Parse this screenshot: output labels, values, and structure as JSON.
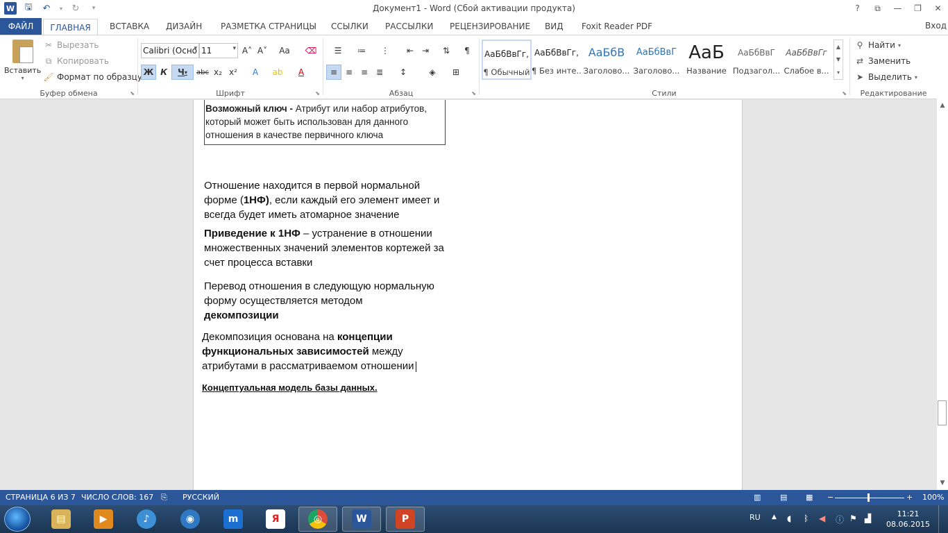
{
  "window": {
    "title": "Документ1 - Word (Сбой активации продукта)",
    "logo": "W",
    "help": "?",
    "controls": [
      "?",
      "⧉",
      "—",
      "❐",
      "✕"
    ]
  },
  "tabs": [
    {
      "label": "ФАЙЛ"
    },
    {
      "label": "ГЛАВНАЯ"
    },
    {
      "label": "ВСТАВКА"
    },
    {
      "label": "ДИЗАЙН"
    },
    {
      "label": "РАЗМЕТКА СТРАНИЦЫ"
    },
    {
      "label": "ССЫЛКИ"
    },
    {
      "label": "РАССЫЛКИ"
    },
    {
      "label": "РЕЦЕНЗИРОВАНИЕ"
    },
    {
      "label": "ВИД"
    },
    {
      "label": "Foxit Reader PDF"
    }
  ],
  "signin": "Вход",
  "clipboard": {
    "paste": "Вставить",
    "cut": "Вырезать",
    "copy": "Копировать",
    "format_painter": "Формат по образцу",
    "group": "Буфер обмена"
  },
  "font": {
    "name": "Calibri (Осно",
    "size": "11",
    "group": "Шрифт",
    "bold": "Ж",
    "italic": "К",
    "underline": "Ч",
    "strike": "abc",
    "sub": "x₂",
    "sup": "x²",
    "grow": "A˄",
    "shrink": "A˅",
    "case": "Aa",
    "clear": "A"
  },
  "paragraph": {
    "group": "Абзац"
  },
  "styles": {
    "group": "Стили",
    "items": [
      {
        "sample": "АаБбВвГг,",
        "name": "¶ Обычный"
      },
      {
        "sample": "АаБбВвГг,",
        "name": "¶ Без инте..."
      },
      {
        "sample": "АаБбВ",
        "name": "Заголово..."
      },
      {
        "sample": "АаБбВвГ",
        "name": "Заголово..."
      },
      {
        "sample": "АаБ",
        "name": "Название"
      },
      {
        "sample": "АаБбВвГ",
        "name": "Подзагол..."
      },
      {
        "sample": "АаБбВвГг",
        "name": "Слабое в..."
      }
    ]
  },
  "editing": {
    "group": "Редактирование",
    "find": "Найти",
    "replace": "Заменить",
    "select": "Выделить"
  },
  "document": {
    "def_bold": "Возможный ключ -",
    "def_text": " Атрибут или набор атрибутов, который может быть использован для данного отношения в качестве первичного ключа",
    "p1_a": "Отношение находится в первой нормальной форме (",
    "p1_b": "1НФ)",
    "p1_c": ", если каждый его элемент имеет и всегда будет иметь атомарное значение",
    "p2_a": "Приведение к 1НФ",
    "p2_b": " – устранение в отношении множественных значений элементов кортежей за счет процесса вставки",
    "p3_a": "Перевод отношения в следующую нормальную форму осуществляется методом ",
    "p3_b": "декомпозиции",
    "p4_a": "Декомпозиция основана на ",
    "p4_b": "концепции функциональных зависимостей",
    "p4_c": " между атрибутами в рассматриваемом отношении",
    "heading": "Концептуальная модель базы данных."
  },
  "status": {
    "page": "СТРАНИЦА 6 ИЗ 7",
    "words": "ЧИСЛО СЛОВ: 167",
    "language": "РУССКИЙ",
    "zoom": "100%",
    "zoom_level_percent": 100
  },
  "taskbar": {
    "apps": [
      {
        "name": "explorer",
        "color": "#d9b25a",
        "glyph": "▤"
      },
      {
        "name": "media",
        "color": "#e08a1e",
        "glyph": "▶"
      },
      {
        "name": "audio",
        "color": "#3d8fd6",
        "glyph": "♪"
      },
      {
        "name": "globe",
        "color": "#2f79c4",
        "glyph": "◉"
      },
      {
        "name": "maxthon",
        "color": "#1a6fd1",
        "glyph": "m"
      },
      {
        "name": "yandex",
        "color": "#ffffff",
        "glyph": "Я"
      },
      {
        "name": "chrome",
        "color": "#dd4b39",
        "glyph": "◎"
      },
      {
        "name": "word",
        "color": "#2b579a",
        "glyph": "W"
      },
      {
        "name": "powerpoint",
        "color": "#d04423",
        "glyph": "P"
      }
    ],
    "lang": "RU",
    "time": "11:21",
    "date": "08.06.2015"
  }
}
